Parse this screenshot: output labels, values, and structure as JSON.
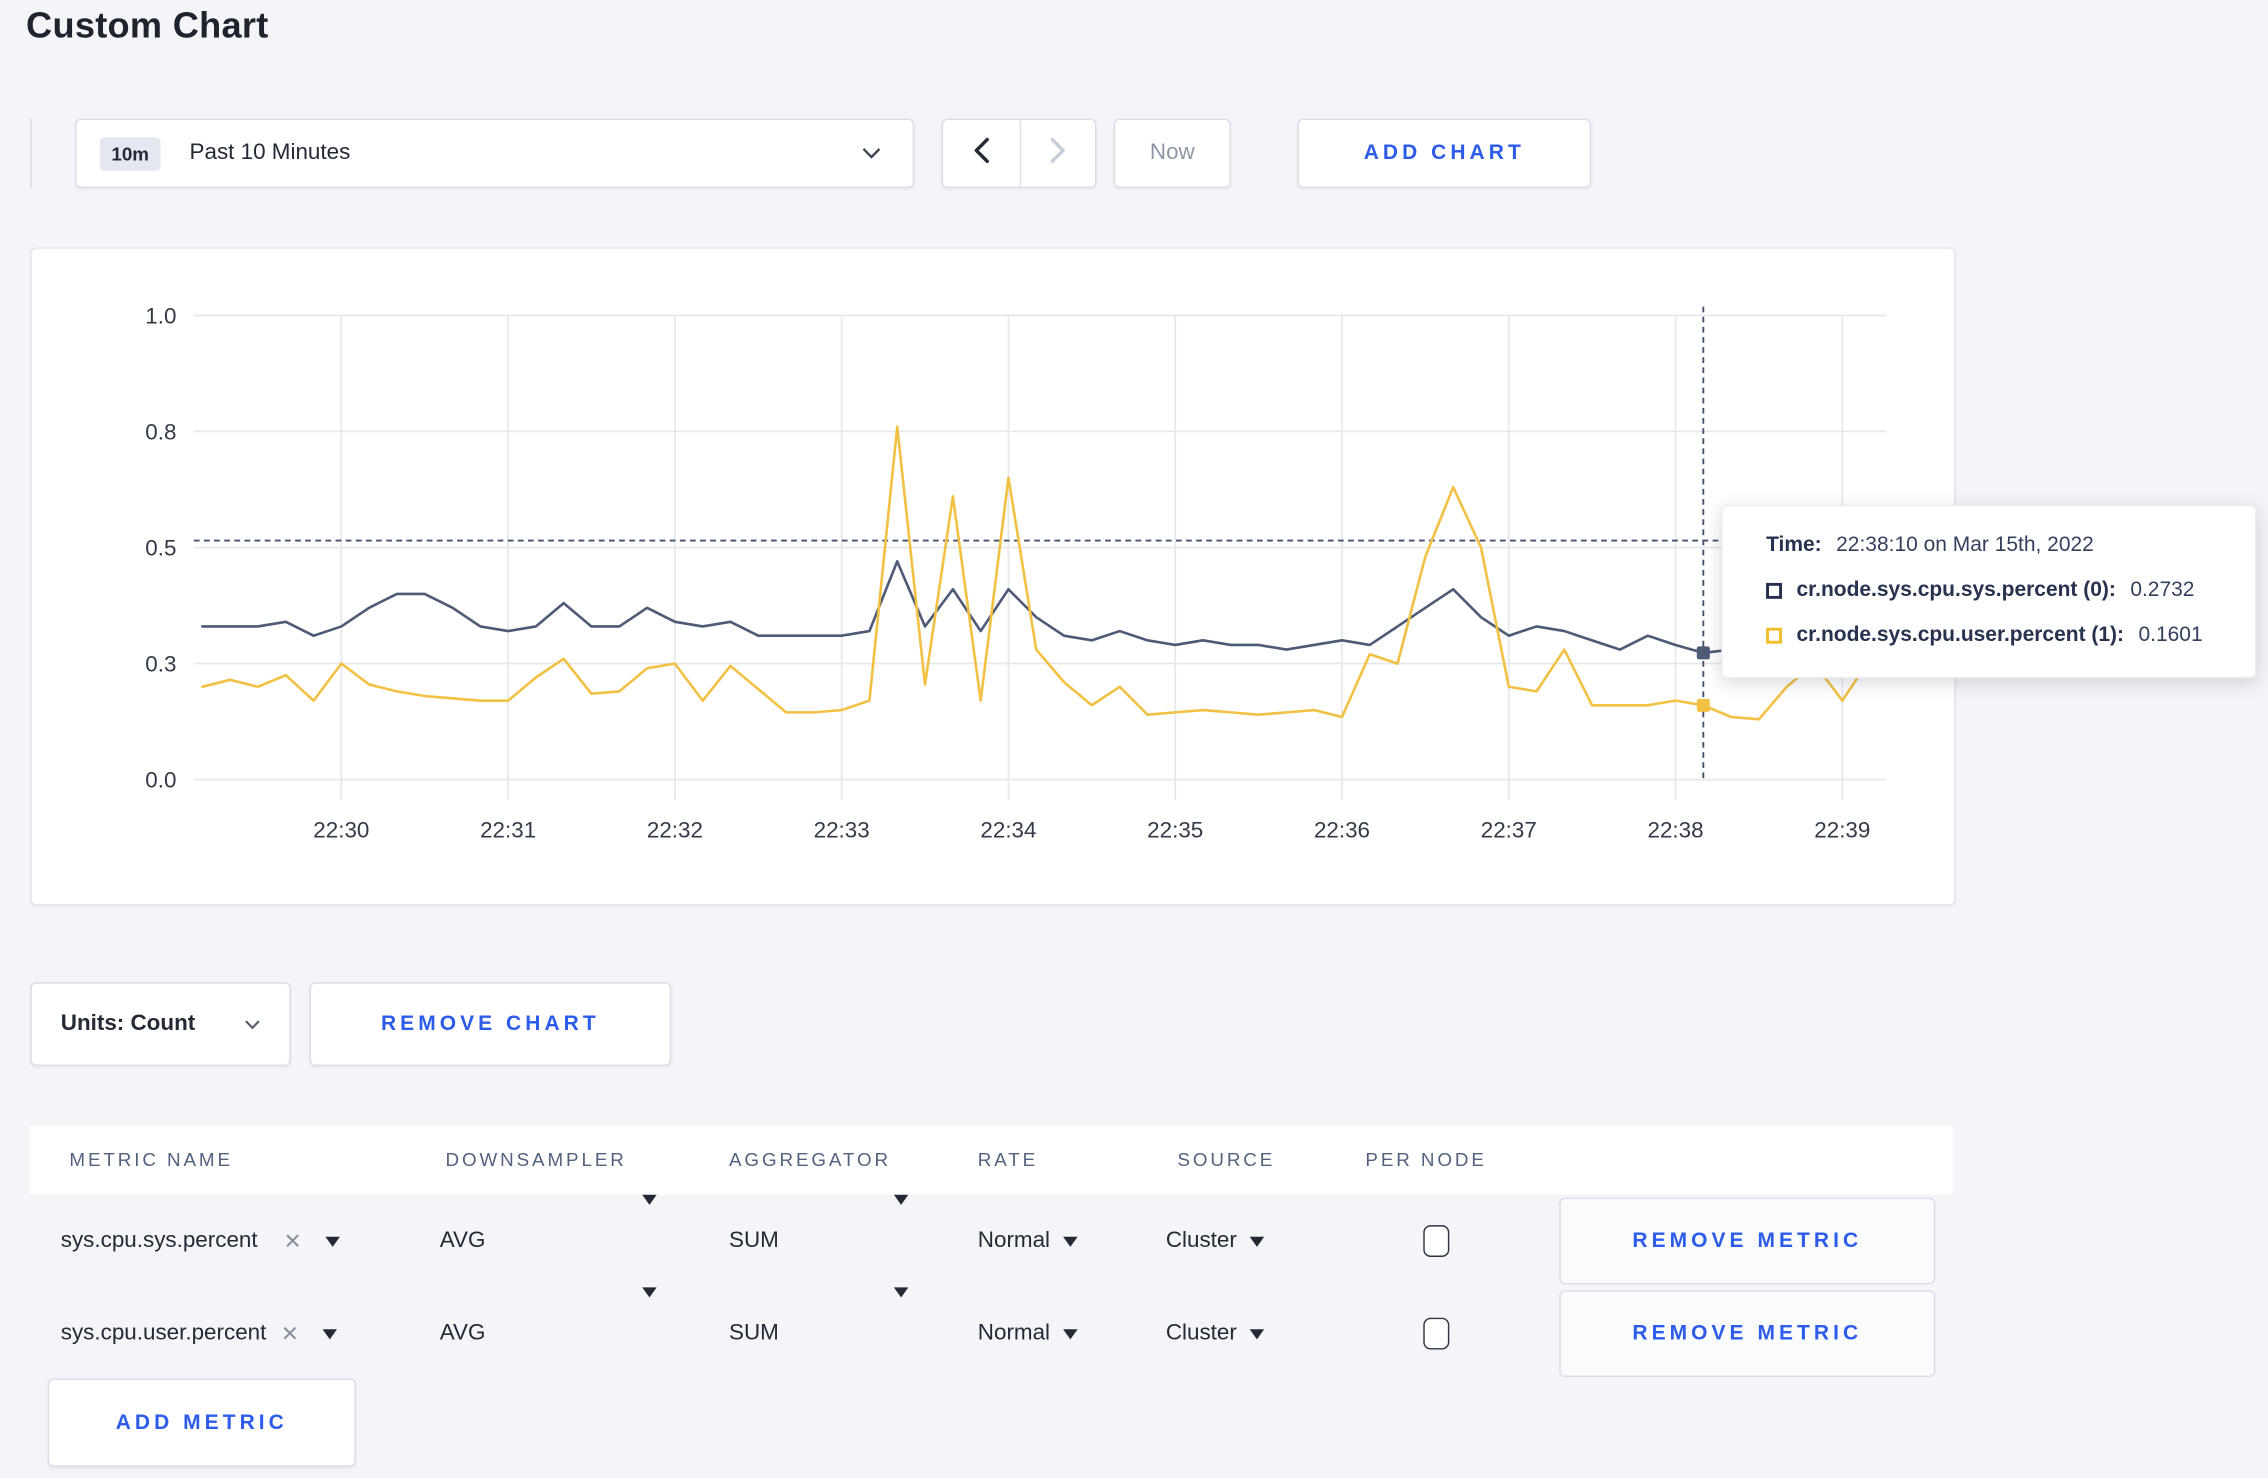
{
  "page": {
    "title": "Custom Chart"
  },
  "colors": {
    "accent_blue": "#2d5cea",
    "page_bg": "#f4f5f9",
    "navy_text": "#242a35",
    "grid_line": "#e7e8ec",
    "crosshair": "#46536e"
  },
  "icons": {
    "time_range_chevron": "chevron-down-icon",
    "prev": "chevron-left-icon",
    "next": "chevron-right-icon",
    "units_chevron": "chevron-down-icon",
    "metric_clear": "x-icon",
    "dropdown_caret": "triangle-down-icon"
  },
  "toolbar": {
    "time_range": {
      "badge": "10m",
      "label": "Past 10 Minutes"
    },
    "now_label": "Now",
    "add_chart_label": "ADD CHART"
  },
  "chart_data": {
    "type": "line",
    "title": "",
    "xlabel": "",
    "ylabel": "",
    "ylim": [
      0,
      1
    ],
    "grid": true,
    "legend_position": "hover-tooltip",
    "x_ticks": [
      "22:30",
      "22:31",
      "22:32",
      "22:33",
      "22:34",
      "22:35",
      "22:36",
      "22:37",
      "22:38",
      "22:39"
    ],
    "y_tick_labels": [
      "1.0",
      "0.8",
      "0.5",
      "0.3",
      "0.0"
    ],
    "y_tick_values": [
      1.0,
      0.75,
      0.5,
      0.25,
      0.0
    ],
    "x_start": "22:29:10",
    "x_interval_seconds": 10,
    "series": [
      {
        "name": "cr.node.sys.cpu.sys.percent",
        "color": "#4e5b76",
        "values": [
          0.33,
          0.33,
          0.33,
          0.34,
          0.31,
          0.33,
          0.37,
          0.4,
          0.4,
          0.37,
          0.33,
          0.32,
          0.33,
          0.38,
          0.33,
          0.33,
          0.37,
          0.34,
          0.33,
          0.34,
          0.31,
          0.31,
          0.31,
          0.31,
          0.32,
          0.47,
          0.33,
          0.41,
          0.32,
          0.41,
          0.35,
          0.31,
          0.3,
          0.32,
          0.3,
          0.29,
          0.3,
          0.29,
          0.29,
          0.28,
          0.29,
          0.3,
          0.29,
          0.33,
          0.37,
          0.41,
          0.35,
          0.31,
          0.33,
          0.32,
          0.3,
          0.28,
          0.31,
          0.29,
          0.273,
          0.28,
          0.29,
          0.3,
          0.3,
          0.31,
          0.3
        ]
      },
      {
        "name": "cr.node.sys.cpu.user.percent",
        "color": "#f2c144",
        "values": [
          0.2,
          0.215,
          0.2,
          0.225,
          0.17,
          0.25,
          0.205,
          0.19,
          0.18,
          0.175,
          0.17,
          0.17,
          0.22,
          0.26,
          0.185,
          0.19,
          0.24,
          0.25,
          0.17,
          0.245,
          0.195,
          0.145,
          0.145,
          0.15,
          0.17,
          0.76,
          0.205,
          0.61,
          0.17,
          0.65,
          0.28,
          0.21,
          0.16,
          0.2,
          0.14,
          0.145,
          0.15,
          0.145,
          0.14,
          0.145,
          0.15,
          0.135,
          0.27,
          0.25,
          0.48,
          0.63,
          0.5,
          0.2,
          0.19,
          0.28,
          0.16,
          0.16,
          0.16,
          0.17,
          0.16,
          0.135,
          0.13,
          0.2,
          0.25,
          0.17,
          0.26
        ]
      }
    ],
    "crosshair": {
      "time": "22:38:10",
      "x_index": 54,
      "hline_value": 0.515
    }
  },
  "tooltip": {
    "time_label": "Time:",
    "time_value": "22:38:10 on Mar 15th, 2022",
    "series": [
      {
        "name": "cr.node.sys.cpu.sys.percent (0):",
        "value": "0.2732",
        "swatch_color": "#242f4e"
      },
      {
        "name": "cr.node.sys.cpu.user.percent (1):",
        "value": "0.1601",
        "swatch_color": "#f2be2c"
      }
    ]
  },
  "units": {
    "label": "Units: Count"
  },
  "remove_chart_label": "REMOVE CHART",
  "metrics_table": {
    "columns": [
      "METRIC NAME",
      "DOWNSAMPLER",
      "AGGREGATOR",
      "RATE",
      "SOURCE",
      "PER NODE"
    ],
    "rows": [
      {
        "metric": "sys.cpu.sys.percent",
        "downsampler": "AVG",
        "aggregator": "SUM",
        "rate": "Normal",
        "source": "Cluster",
        "per_node_checked": false,
        "remove_label": "REMOVE METRIC"
      },
      {
        "metric": "sys.cpu.user.percent",
        "downsampler": "AVG",
        "aggregator": "SUM",
        "rate": "Normal",
        "source": "Cluster",
        "per_node_checked": false,
        "remove_label": "REMOVE METRIC"
      }
    ],
    "add_metric_label": "ADD METRIC"
  }
}
